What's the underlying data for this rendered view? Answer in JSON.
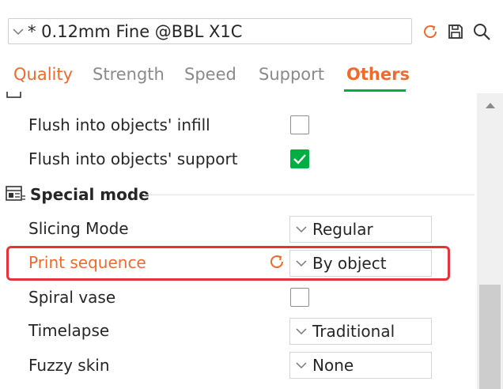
{
  "preset": {
    "value": "* 0.12mm Fine @BBL X1C"
  },
  "tabs": [
    {
      "label": "Quality"
    },
    {
      "label": "Strength"
    },
    {
      "label": "Speed"
    },
    {
      "label": "Support"
    },
    {
      "label": "Others"
    }
  ],
  "active_tab": "Others",
  "rows": {
    "flush_infill": {
      "label": "Flush into objects' infill",
      "checked": false
    },
    "flush_support": {
      "label": "Flush into objects' support",
      "checked": true
    }
  },
  "section": {
    "title": "Special mode"
  },
  "special": {
    "slicing_mode": {
      "label": "Slicing Mode",
      "value": "Regular"
    },
    "print_sequence": {
      "label": "Print sequence",
      "value": "By object"
    },
    "spiral_vase": {
      "label": "Spiral vase",
      "checked": false
    },
    "timelapse": {
      "label": "Timelapse",
      "value": "Traditional"
    },
    "fuzzy_skin": {
      "label": "Fuzzy skin",
      "value": "None"
    }
  },
  "colors": {
    "accent_orange": "#f26a2b",
    "accent_green": "#00ae42",
    "highlight_red": "#e8323a"
  }
}
